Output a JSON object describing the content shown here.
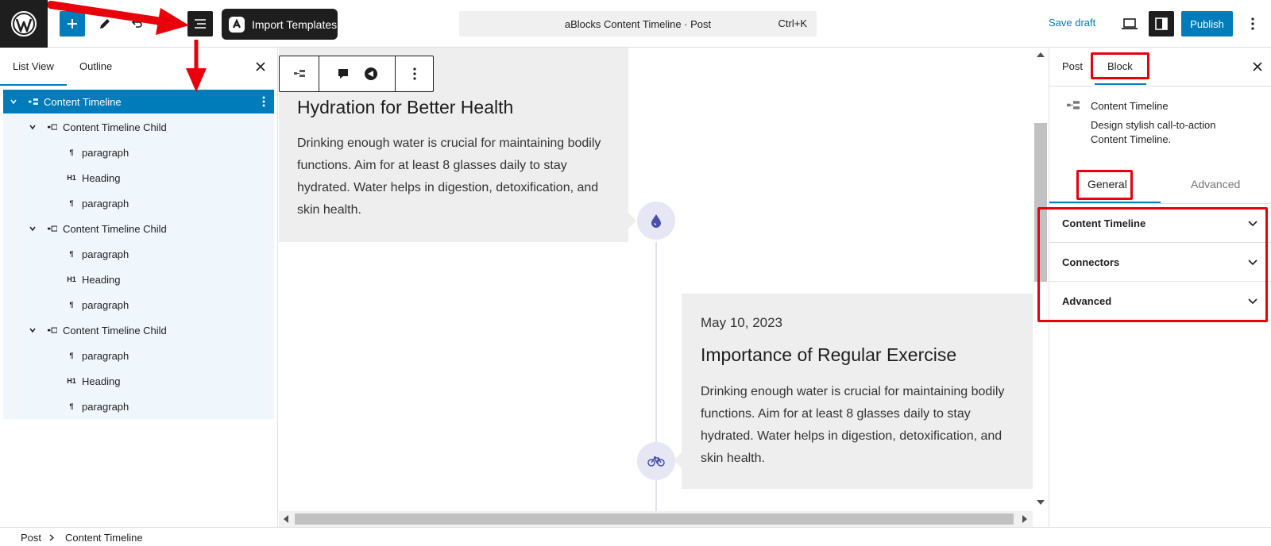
{
  "header": {
    "import_label": "Import Templates",
    "command_title": "aBlocks Content Timeline · Post",
    "command_shortcut": "Ctrl+K",
    "save_draft": "Save draft",
    "publish": "Publish",
    "accent_color": "#007cba"
  },
  "list_panel": {
    "tabs": [
      {
        "label": "List View",
        "active": true
      },
      {
        "label": "Outline",
        "active": false
      }
    ],
    "tree": [
      {
        "label": "Content Timeline",
        "level": 0,
        "icon": "timeline-block-icon",
        "selected": true
      },
      {
        "label": "Content Timeline Child",
        "level": 1,
        "icon": "timeline-child-icon"
      },
      {
        "label": "paragraph",
        "level": 2,
        "icon": "paragraph-icon"
      },
      {
        "label": "Heading",
        "level": 2,
        "icon": "heading-icon"
      },
      {
        "label": "paragraph",
        "level": 2,
        "icon": "paragraph-icon"
      },
      {
        "label": "Content Timeline Child",
        "level": 1,
        "icon": "timeline-child-icon"
      },
      {
        "label": "paragraph",
        "level": 2,
        "icon": "paragraph-icon"
      },
      {
        "label": "Heading",
        "level": 2,
        "icon": "heading-icon"
      },
      {
        "label": "paragraph",
        "level": 2,
        "icon": "paragraph-icon"
      },
      {
        "label": "Content Timeline Child",
        "level": 1,
        "icon": "timeline-child-icon"
      },
      {
        "label": "paragraph",
        "level": 2,
        "icon": "paragraph-icon"
      },
      {
        "label": "Heading",
        "level": 2,
        "icon": "heading-icon"
      },
      {
        "label": "paragraph",
        "level": 2,
        "icon": "paragraph-icon"
      }
    ],
    "heading_glyph": "H1",
    "paragraph_glyph": "¶"
  },
  "canvas": {
    "items": [
      {
        "title": "Hydration for Better Health",
        "body": "Drinking enough water is crucial for maintaining bodily functions. Aim for at least 8 glasses daily to stay hydrated. Water helps in digestion, detoxification, and skin health.",
        "icon": "water-drop-icon"
      },
      {
        "date": "May 10, 2023",
        "title": "Importance of Regular Exercise",
        "body": "Drinking enough water is crucial for maintaining bodily functions. Aim for at least 8 glasses daily to stay hydrated. Water helps in digestion, detoxification, and skin health.",
        "icon": "bicycle-icon"
      }
    ]
  },
  "sidebar": {
    "tabs": [
      {
        "label": "Post",
        "active": false
      },
      {
        "label": "Block",
        "active": true
      }
    ],
    "block": {
      "title": "Content Timeline",
      "description": "Design stylish call-to-action Content Timeline."
    },
    "subtabs": [
      {
        "label": "General",
        "active": true
      },
      {
        "label": "Advanced",
        "active": false
      }
    ],
    "panels": [
      {
        "label": "Content Timeline"
      },
      {
        "label": "Connectors"
      },
      {
        "label": "Advanced"
      }
    ]
  },
  "footer": {
    "breadcrumb": [
      "Post",
      "Content Timeline"
    ]
  },
  "annotation_color": "#e8000b"
}
